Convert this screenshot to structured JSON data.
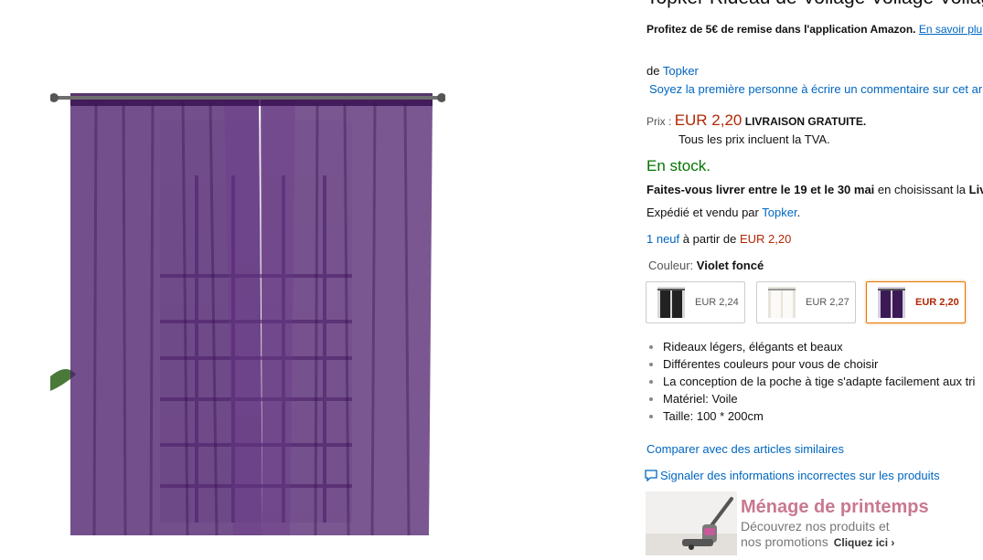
{
  "product": {
    "title": "Topker Rideau de Voilage Voilage Voilage V",
    "promo_text": "Profitez de 5€ de remise dans l'application Amazon.",
    "promo_link": "En savoir plu",
    "brand_prefix": "de",
    "brand": "Topker",
    "review_link": "Soyez la première personne à écrire un commentaire sur cet ar",
    "price_label": "Prix :",
    "price": "EUR 2,20",
    "free_shipping": "LIVRAISON GRATUITE.",
    "tax_note": "Tous les prix incluent la TVA.",
    "stock": "En stock.",
    "delivery_prefix": "Faites-vous livrer entre le 19 et le 30 mai",
    "delivery_suffix": "en choisissant la",
    "delivery_bold_tail": "Liv",
    "shipped_prefix": "Expédié et vendu par",
    "shipped_by": "Topker",
    "shipped_suffix": ".",
    "offers_link": "1 neuf",
    "offers_middle": "à partir de",
    "offers_price": "EUR 2,20",
    "color_label": "Couleur:",
    "color_value": "Violet foncé",
    "swatches": [
      {
        "price": "EUR 2,24",
        "color": "#222222",
        "bg": "#d8d8d8"
      },
      {
        "price": "EUR 2,27",
        "color": "#f4f1ea",
        "bg": "#e8e4dc"
      },
      {
        "price": "EUR 2,20",
        "color": "#3c1a56",
        "bg": "#d6cfe0"
      }
    ],
    "bullets": [
      "Rideaux légers, élégants et beaux",
      "Différentes couleurs pour vous de choisir",
      "La conception de la poche à tige s'adapte facilement aux tri",
      "Matériel: Voile",
      "Taille: 100 * 200cm"
    ],
    "compare_link": "Comparer avec des articles similaires",
    "report_link": "Signaler des informations incorrectes sur les produits"
  },
  "banner": {
    "heading": "Ménage de printemps",
    "line1": "Découvrez nos produits et",
    "line2": "nos promotions",
    "cta": "Cliquez ici ›"
  },
  "colors": {
    "link": "#0066c0",
    "price": "#b12704",
    "stock": "#007600",
    "curtain": "#4b1d6b",
    "selected_border": "#e77600",
    "banner_heading": "#c9788f"
  }
}
